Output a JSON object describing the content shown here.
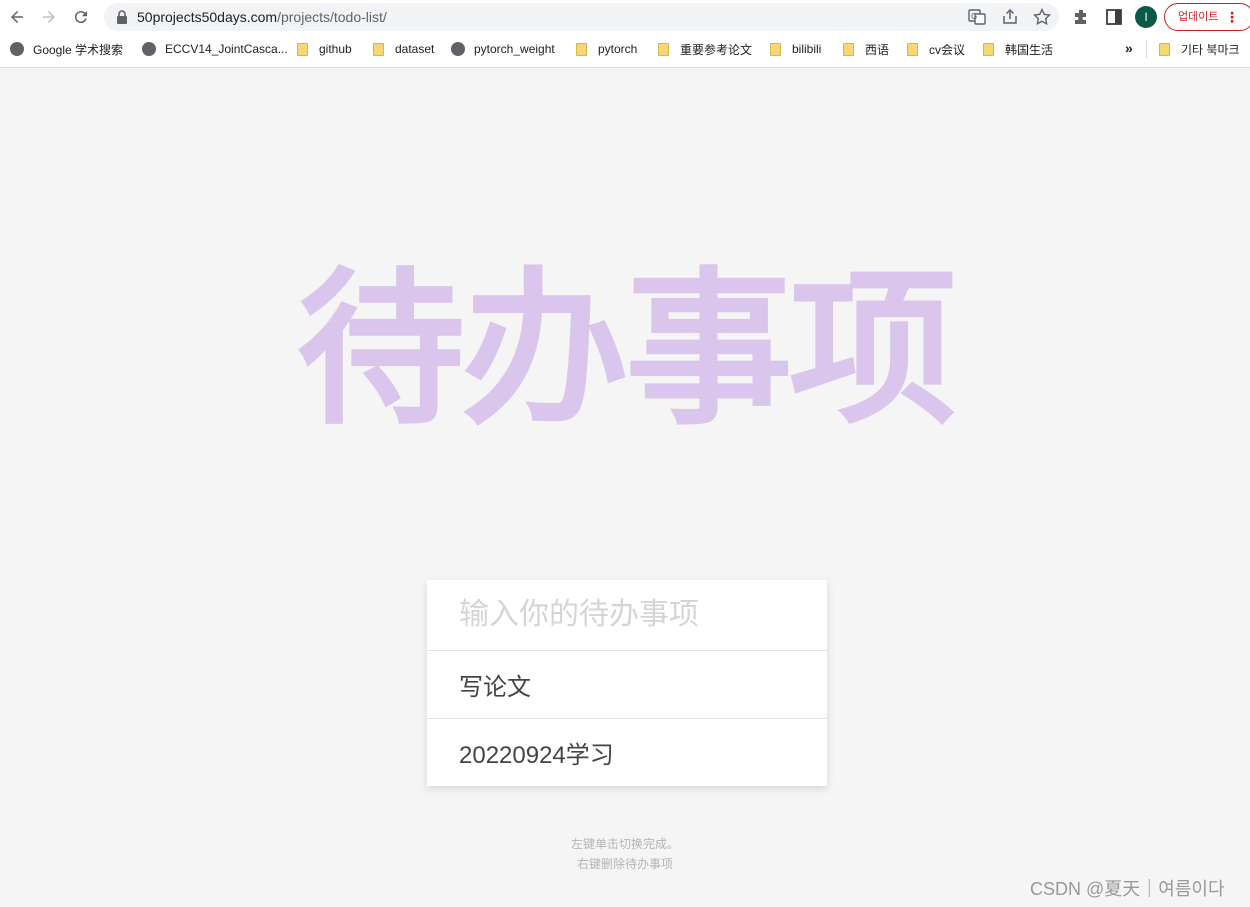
{
  "browser": {
    "url_host": "50projects50days.com",
    "url_path": "/projects/todo-list/",
    "avatar_letter": "I",
    "update_label": "업데이트",
    "bookmarks_overflow_label": "»",
    "other_bookmarks_label": "기타 북마크",
    "bookmarks": [
      {
        "label": "Google 学术搜索",
        "icon": "globe-icon"
      },
      {
        "label": "ECCV14_JointCasca...",
        "icon": "globe-icon"
      },
      {
        "label": "github",
        "icon": "folder-icon"
      },
      {
        "label": "dataset",
        "icon": "folder-icon"
      },
      {
        "label": "pytorch_weight",
        "icon": "globe-icon"
      },
      {
        "label": "pytorch",
        "icon": "folder-icon"
      },
      {
        "label": "重要参考论文",
        "icon": "folder-icon"
      },
      {
        "label": "bilibili",
        "icon": "folder-icon"
      },
      {
        "label": "西语",
        "icon": "folder-icon"
      },
      {
        "label": "cv会议",
        "icon": "folder-icon"
      },
      {
        "label": "韩国生活",
        "icon": "folder-icon"
      }
    ]
  },
  "page": {
    "title": "待办事项",
    "input_placeholder": "输入你的待办事项",
    "todos": [
      {
        "text": "写论文"
      },
      {
        "text": "20220924学习"
      }
    ],
    "hint_line1": "左键单击切换完成。",
    "hint_line2": "右键删除待办事项",
    "watermark": "CSDN @夏天｜여름이다"
  },
  "colors": {
    "title": "#dac6ec",
    "background": "#f5f5f5",
    "update_accent": "#c5221f"
  }
}
